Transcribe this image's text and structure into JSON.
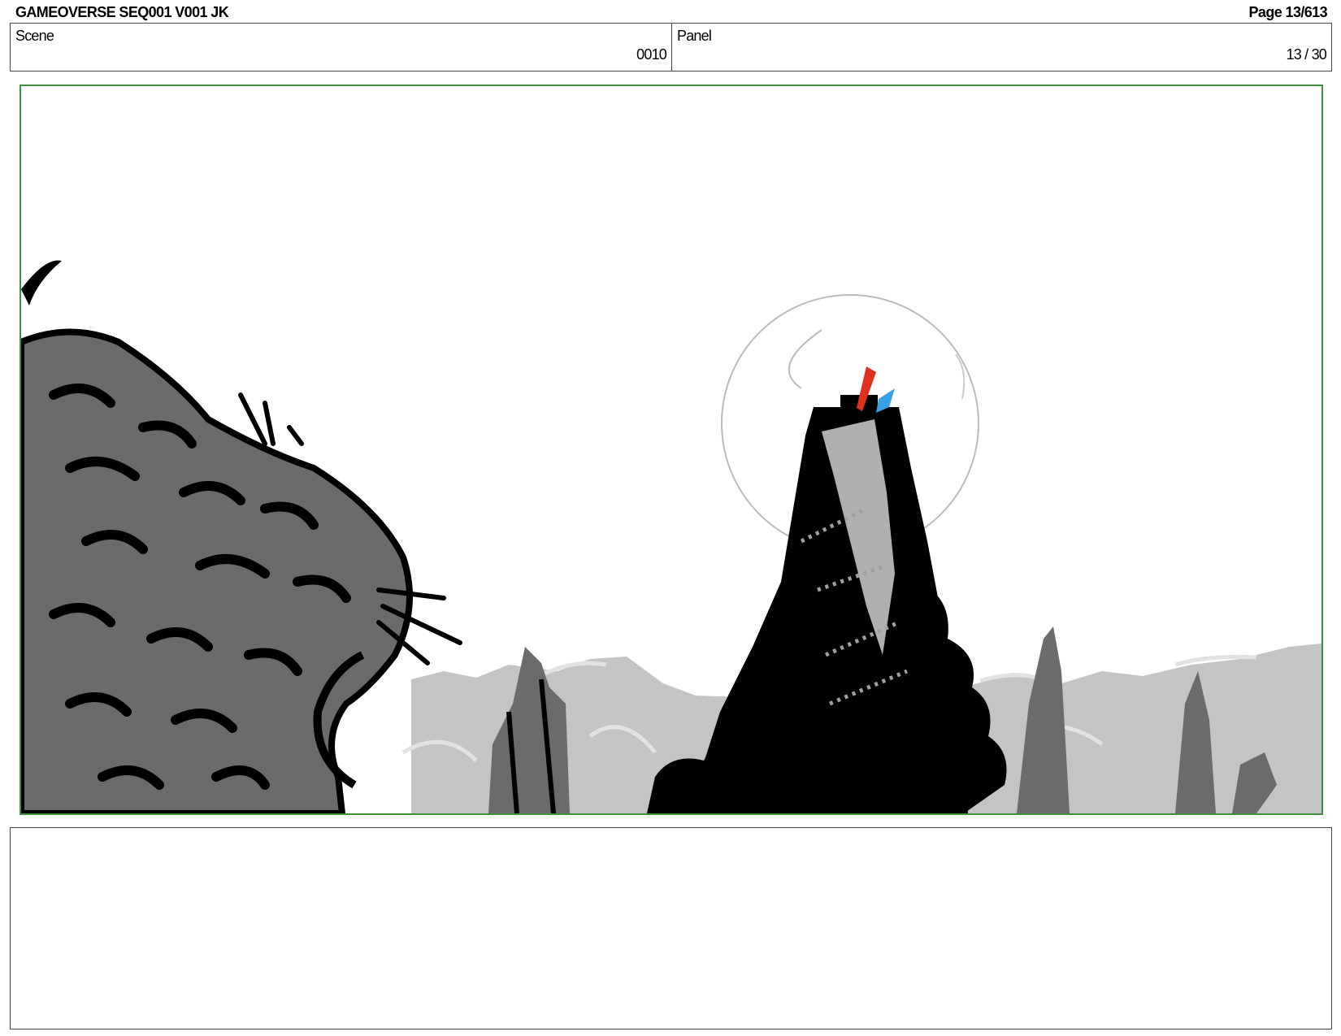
{
  "header": {
    "title": "GAMEOVERSE SEQ001 V001 JK",
    "page": "Page  13/613"
  },
  "info": {
    "scene_label": "Scene",
    "scene_value": "0010",
    "panel_label": "Panel",
    "panel_value": "13 / 30"
  },
  "notes": {
    "text": ""
  },
  "colors": {
    "frame_border": "#3f8f3f",
    "box_border": "#444444",
    "ink": "#000000",
    "mid_gray": "#6b6b6b",
    "light_gray": "#c4c4c4",
    "moon_outline": "#bbbbbb",
    "flag_red": "#e0301e",
    "flag_blue": "#3aa0e8"
  }
}
